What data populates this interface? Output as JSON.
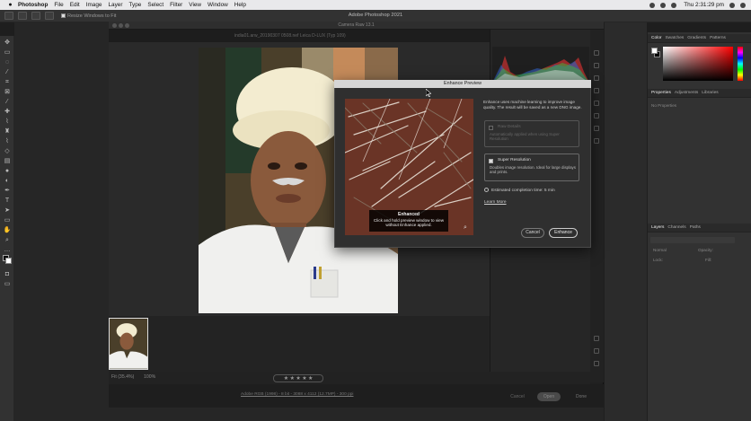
{
  "menubar": {
    "app_name": "Photoshop",
    "items": [
      "File",
      "Edit",
      "Image",
      "Layer",
      "Type",
      "Select",
      "Filter",
      "View",
      "Window",
      "Help"
    ],
    "clock": "Thu 2:31:29 pm"
  },
  "options_bar": {
    "resize_label": "Resize Windows to Fit",
    "window_title": "Adobe Photoshop 2021"
  },
  "camera_raw": {
    "title": "Camera Raw 13.1",
    "file_info": "india01.arw_20190307 0508.nef    Leica D-LUX (Typ 109)",
    "zoom_percent": "Fit (35.4%)",
    "zoom_level": "100%",
    "workflow": "Adobe RGB (1998) - 8 bit - 3088 x 4112 (12.7MP) - 300 ppi",
    "cancel_label": "Cancel",
    "open_label": "Open",
    "done_label": "Done",
    "rating_stars": "★ ★ ★ ★ ★"
  },
  "enhance": {
    "title": "Enhance Preview",
    "description": "Enhance uses machine learning to improve image quality. The result will be saved as a new DNG image.",
    "raw_details_label": "Raw Details",
    "raw_details_desc": "Automatically applied when using Super Resolution",
    "super_res_label": "Super Resolution",
    "super_res_desc": "Doubles image resolution. Ideal for large displays and prints.",
    "estimate": "Estimated completion time: 5 min",
    "learn_more": "Learn More",
    "badge_title": "Enhanced",
    "badge_desc": "Click and hold preview window to view without Enhance applied.",
    "cancel_label": "Cancel",
    "enhance_label": "Enhance",
    "super_res_checked": true
  },
  "panels": {
    "color_tabs": [
      "Color",
      "Swatches",
      "Gradients",
      "Patterns"
    ],
    "prop_tabs": [
      "Properties",
      "Adjustments",
      "Libraries"
    ],
    "no_properties": "No Properties",
    "layer_tabs": [
      "Layers",
      "Channels",
      "Paths"
    ],
    "layer_kind": "Kind",
    "blend_mode": "Normal",
    "opacity_label": "Opacity:",
    "lock_label": "Lock:",
    "fill_label": "Fill:"
  }
}
